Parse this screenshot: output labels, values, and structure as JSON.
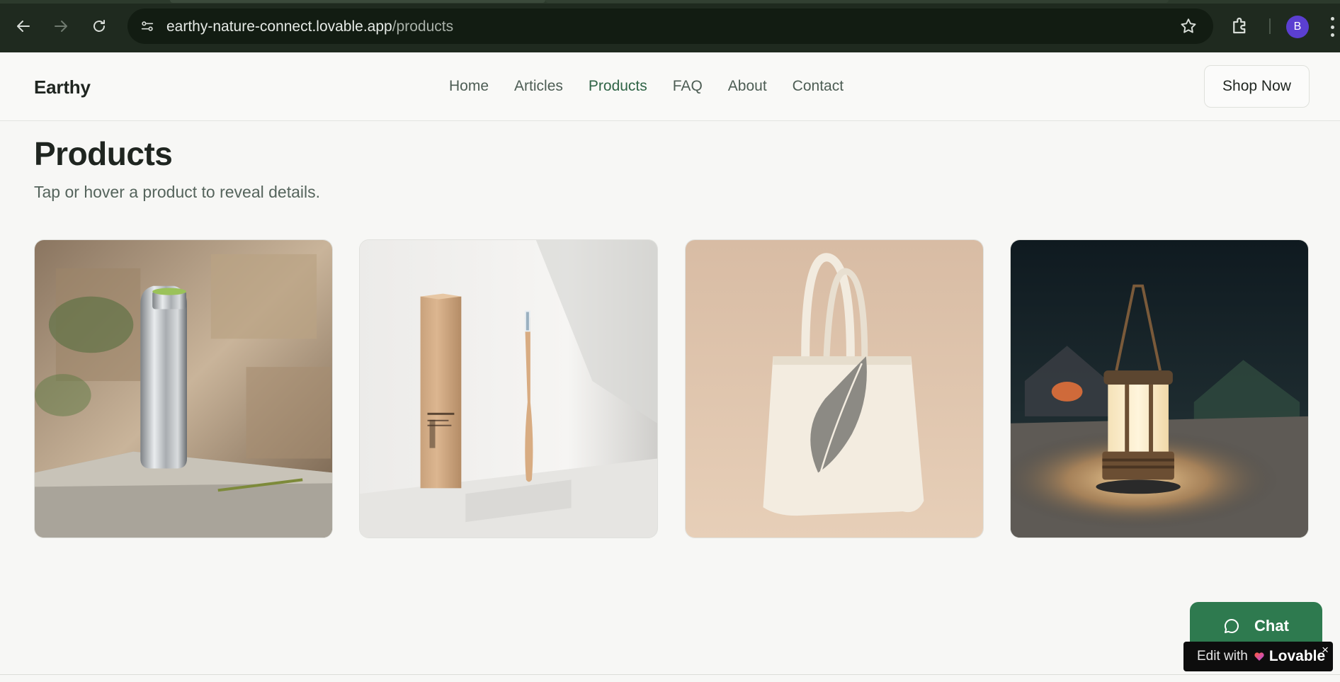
{
  "browser": {
    "url_host": "earthy-nature-connect.lovable.app",
    "url_path": "/products",
    "profile_initial": "B",
    "icons": [
      "back-icon",
      "forward-icon",
      "reload-icon",
      "site-info-icon",
      "bookmark-star-icon",
      "extensions-icon",
      "kebab-menu-icon"
    ]
  },
  "site": {
    "logo": "Earthy",
    "nav": [
      {
        "label": "Home",
        "active": false
      },
      {
        "label": "Articles",
        "active": false
      },
      {
        "label": "Products",
        "active": true
      },
      {
        "label": "FAQ",
        "active": false
      },
      {
        "label": "About",
        "active": false
      },
      {
        "label": "Contact",
        "active": false
      }
    ],
    "cta": "Shop Now"
  },
  "page": {
    "title": "Products",
    "subtitle": "Tap or hover a product to reveal details."
  },
  "products": [
    {
      "image": "stainless-steel-water-bottle"
    },
    {
      "image": "bamboo-toothbrush-with-box"
    },
    {
      "image": "canvas-tote-bag-with-leaf"
    },
    {
      "image": "glowing-camping-lantern"
    }
  ],
  "widgets": {
    "chat_label": "Chat",
    "lovable_prefix": "Edit with",
    "lovable_brand": "Lovable",
    "close_symbol": "×"
  },
  "colors": {
    "accent_green": "#2e7a4f",
    "active_nav": "#2f6446",
    "browser_bar": "#1f2a1f"
  }
}
